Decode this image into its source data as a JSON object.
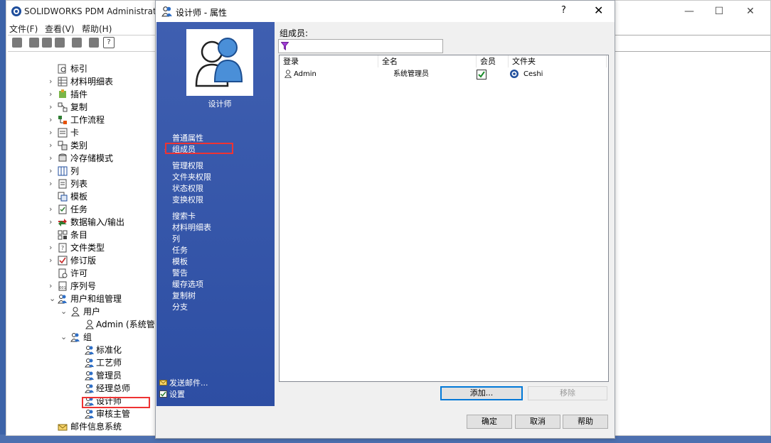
{
  "main_window": {
    "title": "SOLIDWORKS PDM Administration",
    "menu": [
      "文件(F)",
      "查看(V)",
      "帮助(H)"
    ],
    "controls": {
      "minimize": "—",
      "maximize": "☐",
      "close": "✕"
    }
  },
  "tree": {
    "items": [
      {
        "label": "标引",
        "chev": "",
        "icon": "index-icon"
      },
      {
        "label": "材料明细表",
        "chev": "›",
        "icon": "bom-icon"
      },
      {
        "label": "插件",
        "chev": "›",
        "icon": "addin-icon"
      },
      {
        "label": "复制",
        "chev": "›",
        "icon": "copy-icon"
      },
      {
        "label": "工作流程",
        "chev": "›",
        "icon": "workflow-icon"
      },
      {
        "label": "卡",
        "chev": "›",
        "icon": "card-icon"
      },
      {
        "label": "类别",
        "chev": "›",
        "icon": "category-icon"
      },
      {
        "label": "冷存储模式",
        "chev": "›",
        "icon": "cold-storage-icon"
      },
      {
        "label": "列",
        "chev": "›",
        "icon": "column-icon"
      },
      {
        "label": "列表",
        "chev": "›",
        "icon": "list-icon"
      },
      {
        "label": "模板",
        "chev": "",
        "icon": "template-icon"
      },
      {
        "label": "任务",
        "chev": "›",
        "icon": "task-icon"
      },
      {
        "label": "数据输入/输出",
        "chev": "›",
        "icon": "data-io-icon"
      },
      {
        "label": "条目",
        "chev": "",
        "icon": "item-icon"
      },
      {
        "label": "文件类型",
        "chev": "›",
        "icon": "file-type-icon"
      },
      {
        "label": "修订版",
        "chev": "›",
        "icon": "revision-icon"
      },
      {
        "label": "许可",
        "chev": "",
        "icon": "license-icon"
      },
      {
        "label": "序列号",
        "chev": "›",
        "icon": "serial-icon"
      },
      {
        "label": "用户和组管理",
        "chev": "⌄",
        "icon": "users-groups-icon"
      }
    ],
    "users_node": {
      "label": "用户",
      "chev": "⌄"
    },
    "admin_user": "Admin (系统管理",
    "groups_node": {
      "label": "组",
      "chev": "⌄"
    },
    "groups": [
      "标准化",
      "工艺师",
      "管理员",
      "经理总师",
      "设计师",
      "审核主管"
    ],
    "mail_system": "邮件信息系统"
  },
  "dialog": {
    "title": "设计师 - 属性",
    "help": "?",
    "close": "✕",
    "picture_label": "设计师",
    "nav_group1": [
      "普通属性",
      "组成员"
    ],
    "nav_group2": [
      "管理权限",
      "文件夹权限",
      "状态权限",
      "变换权限"
    ],
    "nav_group3": [
      "搜索卡",
      "材料明细表",
      "列",
      "任务",
      "模板",
      "警告",
      "缓存选项",
      "复制树",
      "分支"
    ],
    "side_bottom": [
      "发送邮件...",
      "设置"
    ],
    "members_label": "组成员:",
    "columns": [
      "登录",
      "全名",
      "会员",
      "文件夹"
    ],
    "rows": [
      {
        "login": "Admin",
        "fullname": "系统管理员",
        "member": true,
        "folder": "Ceshi"
      }
    ],
    "add_button": "添加...",
    "remove_button": "移除",
    "ok_button": "确定",
    "cancel_button": "取消",
    "help_button": "帮助"
  }
}
